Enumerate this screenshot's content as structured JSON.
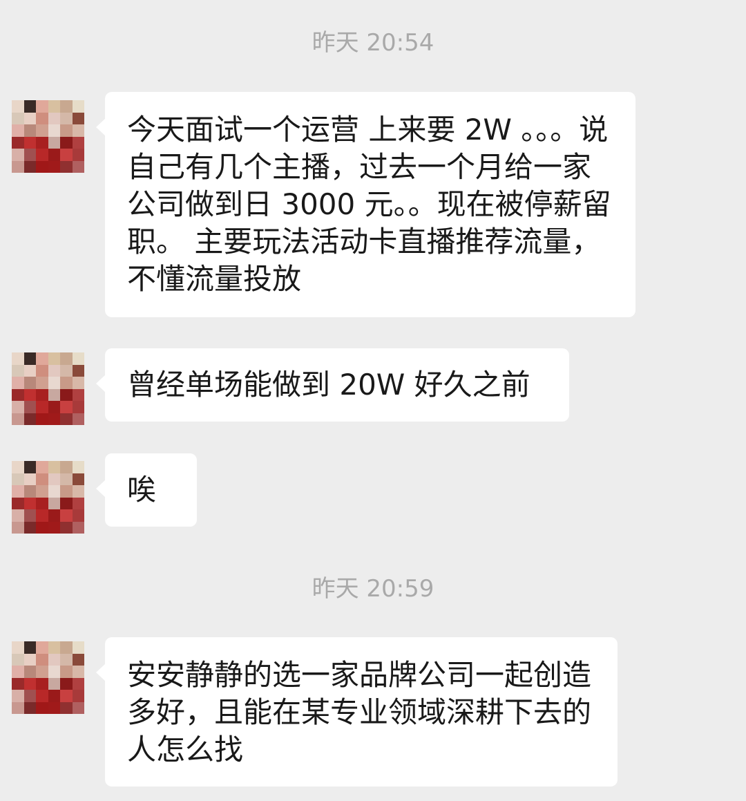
{
  "conversation": {
    "groups": [
      {
        "timestamp": "昨天 20:54",
        "messages": [
          {
            "text": "今天面试一个运营 上来要 2W 。。。说自己有几个主播，过去一个月给一家公司做到日 3000 元。。现在被停薪留职。 主要玩法活动卡直播推荐流量，不懂流量投放"
          },
          {
            "text": "曾经单场能做到 20W 好久之前"
          },
          {
            "text": "唉"
          }
        ]
      },
      {
        "timestamp": "昨天 20:59",
        "messages": [
          {
            "text": "安安静静的选一家品牌公司一起创造多好，且能在某专业领域深耕下去的人怎么找"
          }
        ]
      }
    ]
  },
  "avatar": {
    "pixel_colors": [
      "#e8d6c8",
      "#3a2a26",
      "#e0a89a",
      "#d8c0a0",
      "#c8a890",
      "#e6dcc8",
      "#d8c8b8",
      "#e8cfc4",
      "#cf8e7e",
      "#e2c8c0",
      "#d4b8a8",
      "#8a4a3a",
      "#e0b0a8",
      "#b8887a",
      "#d0a090",
      "#e8d8d0",
      "#c89a88",
      "#d8b8a8",
      "#9a2a2a",
      "#c03030",
      "#a82020",
      "#c8a8a0",
      "#8a1a1a",
      "#b04040",
      "#d8b0a8",
      "#a05050",
      "#b82828",
      "#9a1a1a",
      "#c84040",
      "#a83a3a",
      "#c89890",
      "#7a2a2a",
      "#a01818",
      "#a01a1a",
      "#903030",
      "#b06060"
    ]
  }
}
